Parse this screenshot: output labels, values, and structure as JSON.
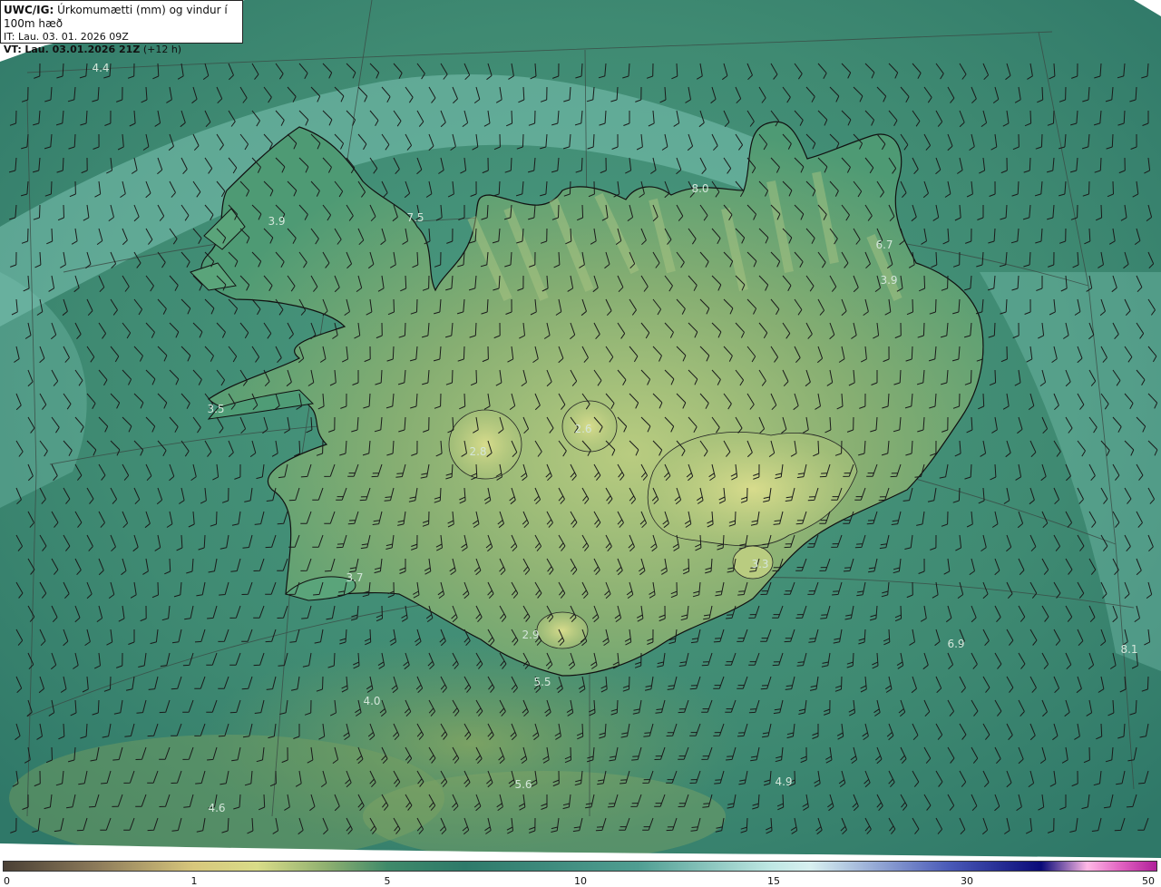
{
  "header": {
    "model": "UWC/IG:",
    "title": "Úrkomumætti (mm) og vindur í 100m hæð",
    "it_line": "IT: Lau. 03. 01. 2026 09Z",
    "vt_prefix": "VT:",
    "vt_bold": "Lau. 03.01.2026 21Z",
    "vt_suffix": "(+12 h)"
  },
  "value_labels": [
    "4.4",
    "3.9",
    "7.5",
    "8.0",
    "6.7",
    "3.9",
    "3.5",
    "2.8",
    "2.6",
    "3.3",
    "3.7",
    "2.9",
    "5.5",
    "4.0",
    "6.9",
    "8.1",
    "5.6",
    "4.9",
    "4.6"
  ],
  "colorbar": {
    "ticks": [
      "0",
      "1",
      "5",
      "10",
      "15",
      "30",
      "50"
    ]
  },
  "colors": {
    "sea_base": "#3f8a72",
    "sea_light": "#7fc4b6",
    "land_low": "#4a9a72",
    "land_high": "#c8d890",
    "coastline": "#111111",
    "wind_barb": "#1a1a1a",
    "label": "#d4e6da"
  },
  "icons": [
    "wind-barb-icon"
  ]
}
